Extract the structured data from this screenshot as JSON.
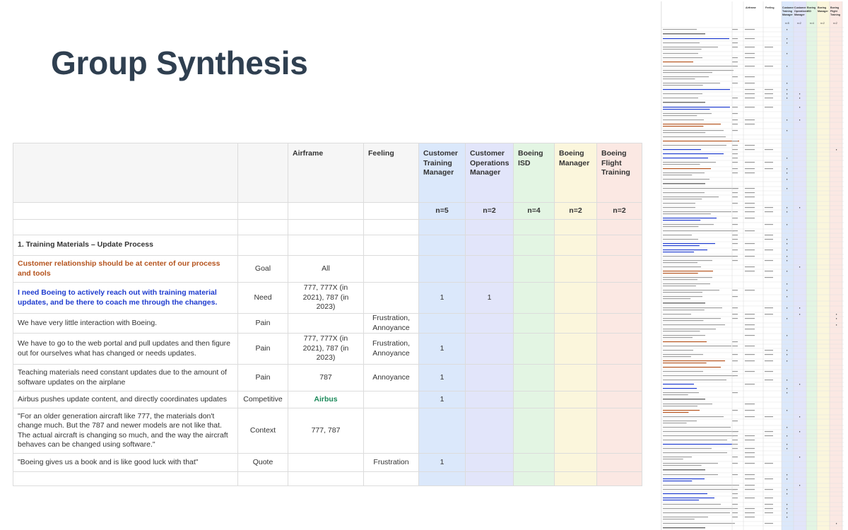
{
  "slide": {
    "title": "Group Synthesis"
  },
  "table": {
    "headers": [
      "",
      "",
      "Airframe",
      "Feeling",
      "Customer Training Manager",
      "Customer Operations Manager",
      "Boeing ISD",
      "Boeing Manager",
      "Boeing Flight Training"
    ],
    "n_values": [
      "n=5",
      "n=2",
      "n=4",
      "n=2",
      "n=2"
    ],
    "section_title": "1. Training Materials – Update Process",
    "rows": [
      {
        "statement": "Customer relationship should be at center of our process and tools",
        "style": "goal",
        "type": "Goal",
        "airframe": "All",
        "feeling": "",
        "ctm": "",
        "com": "",
        "isd": "",
        "mgr": "",
        "flt": ""
      },
      {
        "statement": "I need Boeing to actively reach out with training material updates, and be there to coach me through the changes.",
        "style": "need",
        "type": "Need",
        "airframe": "777, 777X (in 2021), 787 (in 2023)",
        "feeling": "",
        "ctm": "1",
        "com": "1",
        "isd": "",
        "mgr": "",
        "flt": ""
      },
      {
        "statement": "We have very little interaction with Boeing.",
        "style": "",
        "type": "Pain",
        "airframe": "",
        "feeling": "Frustration, Annoyance",
        "ctm": "",
        "com": "",
        "isd": "",
        "mgr": "",
        "flt": ""
      },
      {
        "statement": "We have to go to the web portal and pull updates and then figure out for ourselves what has changed or needs updates.",
        "style": "",
        "type": "Pain",
        "airframe": "777, 777X (in 2021), 787 (in 2023)",
        "feeling": "Frustration, Annoyance",
        "ctm": "1",
        "com": "",
        "isd": "",
        "mgr": "",
        "flt": ""
      },
      {
        "statement": "Teaching materials need constant updates due to the amount of software updates on the airplane",
        "style": "",
        "type": "Pain",
        "airframe": "787",
        "feeling": "Annoyance",
        "ctm": "1",
        "com": "",
        "isd": "",
        "mgr": "",
        "flt": ""
      },
      {
        "statement": "Airbus pushes update content, and directly coordinates updates",
        "style": "",
        "type": "Competitive",
        "airframe": "Airbus",
        "feeling": "",
        "ctm": "1",
        "com": "",
        "isd": "",
        "mgr": "",
        "flt": ""
      },
      {
        "statement": "\"For an older generation aircraft like 777, the materials don't change much. But the 787 and newer models are not like that. The actual aircraft is changing so much, and the way the aircraft behaves can be changed using software.\"",
        "style": "",
        "type": "Context",
        "airframe": "777, 787",
        "feeling": "",
        "ctm": "",
        "com": "",
        "isd": "",
        "mgr": "",
        "flt": ""
      },
      {
        "statement": "\"Boeing gives us a book and is like good luck with that\"",
        "style": "",
        "type": "Quote",
        "airframe": "",
        "feeling": "Frustration",
        "ctm": "1",
        "com": "",
        "isd": "",
        "mgr": "",
        "flt": ""
      }
    ]
  },
  "thumbnail": {
    "headers": [
      "Airframe",
      "Feeling",
      "Customer Training Manager",
      "Customer Operations Manager",
      "Boeing ISD",
      "Boeing Manager",
      "Boeing Flight Training"
    ],
    "n_values": [
      "n=5",
      "n=2",
      "n=4",
      "n=2",
      "n=2"
    ]
  },
  "colors": {
    "title": "#2f3f50",
    "goal": "#b5541e",
    "need": "#1f3ccf",
    "airbus": "#1b8a5a",
    "ctm": "#dbe8fb",
    "com": "#e2e5fa",
    "isd": "#e3f5e3",
    "mgr": "#fbf6dc",
    "flt": "#fbe8e3"
  }
}
